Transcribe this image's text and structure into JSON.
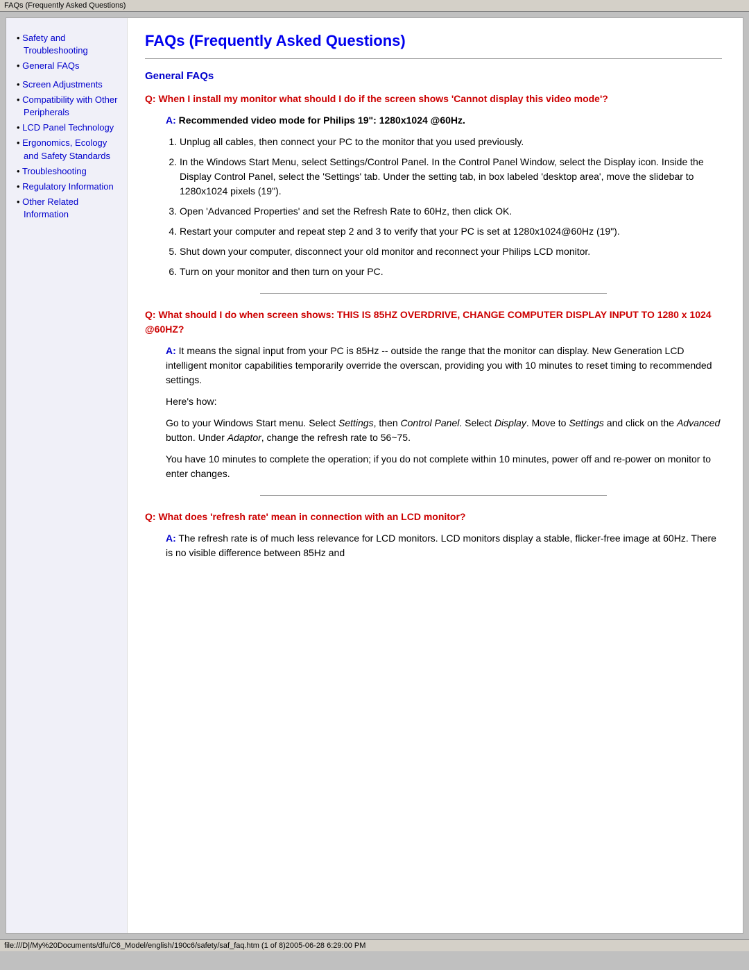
{
  "titleBar": {
    "text": "FAQs (Frequently Asked Questions)"
  },
  "sidebar": {
    "items": [
      {
        "label": "Safety and Troubleshooting",
        "href": "#"
      },
      {
        "label": "General FAQs",
        "href": "#"
      },
      {
        "label": "Screen Adjustments",
        "href": "#"
      },
      {
        "label": "Compatibility with Other Peripherals",
        "href": "#"
      },
      {
        "label": "LCD Panel Technology",
        "href": "#"
      },
      {
        "label": "Ergonomics, Ecology and Safety Standards",
        "href": "#"
      },
      {
        "label": "Troubleshooting",
        "href": "#"
      },
      {
        "label": "Regulatory Information",
        "href": "#"
      },
      {
        "label": "Other Related Information",
        "href": "#"
      }
    ]
  },
  "page": {
    "title": "FAQs (Frequently Asked Questions)",
    "sectionTitle": "General FAQs",
    "q1": {
      "question": "Q: When I install my monitor what should I do if the screen shows 'Cannot display this video mode'?",
      "answerLabel": "A:",
      "answerBold": "Recommended video mode for Philips 19\": 1280x1024 @60Hz.",
      "steps": [
        "Unplug all cables, then connect your PC to the monitor that you used previously.",
        "In the Windows Start Menu, select Settings/Control Panel. In the Control Panel Window, select the Display icon. Inside the Display Control Panel, select the 'Settings' tab. Under the setting tab, in box labeled 'desktop area', move the slidebar to 1280x1024 pixels (19\").",
        "Open 'Advanced Properties' and set the Refresh Rate to 60Hz, then click OK.",
        "Restart your computer and repeat step 2 and 3 to verify that your PC is set at 1280x1024@60Hz (19\").",
        "Shut down your computer, disconnect your old monitor and reconnect your Philips LCD monitor.",
        "Turn on your monitor and then turn on your PC."
      ]
    },
    "q2": {
      "question": "Q: What should I do when screen shows: THIS IS 85HZ OVERDRIVE, CHANGE COMPUTER DISPLAY INPUT TO 1280 x 1024 @60HZ?",
      "answerLabel": "A:",
      "answerText": "It means the signal input from your PC is 85Hz -- outside the range that the monitor can display. New Generation LCD intelligent monitor capabilities temporarily override the overscan, providing you with 10 minutes to reset timing to recommended settings.",
      "heresHow": "Here's how:",
      "goTo": "Go to your Windows Start menu. Select Settings, then Control Panel. Select Display. Move to Settings and click on the Advanced button. Under Adaptor, change the refresh rate to 56~75.",
      "tenMinutes": "You have 10 minutes to complete the operation; if you do not complete within 10 minutes, power off and re-power on monitor to enter changes."
    },
    "q3": {
      "question": "Q: What does 'refresh rate' mean in connection with an LCD monitor?",
      "answerLabel": "A:",
      "answerText": "The refresh rate is of much less relevance for LCD monitors. LCD monitors display a stable, flicker-free image at 60Hz. There is no visible difference between 85Hz and"
    }
  },
  "statusBar": {
    "text": "file:///D|/My%20Documents/dfu/C6_Model/english/190c6/safety/saf_faq.htm (1 of 8)2005-06-28 6:29:00 PM"
  }
}
